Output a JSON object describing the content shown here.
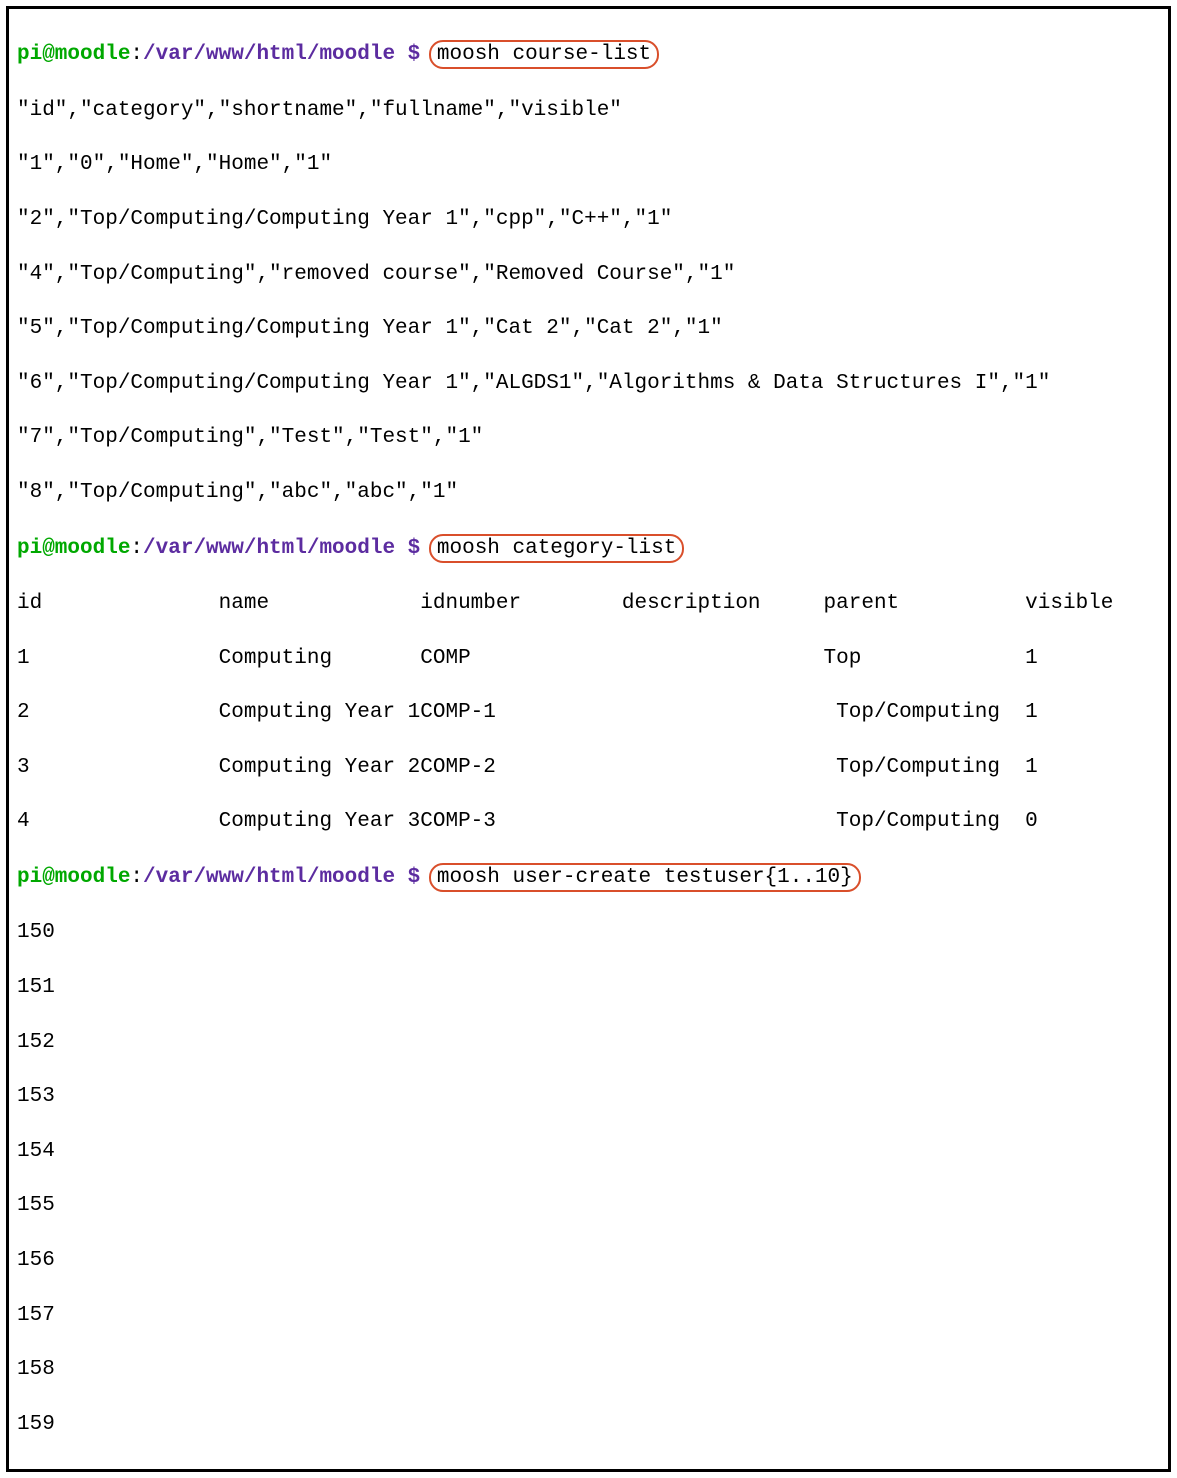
{
  "prompt": {
    "user": "pi@moodle",
    "sep": ":",
    "path": "/var/www/html/moodle",
    "dollar": " $ "
  },
  "cmd1": "moosh course-list",
  "course_header": "\"id\",\"category\",\"shortname\",\"fullname\",\"visible\"",
  "course_rows": [
    "\"1\",\"0\",\"Home\",\"Home\",\"1\"",
    "\"2\",\"Top/Computing/Computing Year 1\",\"cpp\",\"C++\",\"1\"",
    "\"4\",\"Top/Computing\",\"removed course\",\"Removed Course\",\"1\"",
    "\"5\",\"Top/Computing/Computing Year 1\",\"Cat 2\",\"Cat 2\",\"1\"",
    "\"6\",\"Top/Computing/Computing Year 1\",\"ALGDS1\",\"Algorithms & Data Structures I\",\"1\"",
    "\"7\",\"Top/Computing\",\"Test\",\"Test\",\"1\"",
    "\"8\",\"Top/Computing\",\"abc\",\"abc\",\"1\""
  ],
  "cmd2": "moosh category-list",
  "cat_header": "id              name            idnumber        description     parent          visible",
  "cat_rows": [
    "1               Computing       COMP                            Top             1",
    "2               Computing Year 1COMP-1                           Top/Computing  1",
    "3               Computing Year 2COMP-2                           Top/Computing  1",
    "4               Computing Year 3COMP-3                           Top/Computing  0"
  ],
  "cmd3": "moosh user-create testuser{1..10}",
  "user_ids": [
    "150",
    "151",
    "152",
    "153",
    "154",
    "155",
    "156",
    "157",
    "158",
    "159"
  ]
}
